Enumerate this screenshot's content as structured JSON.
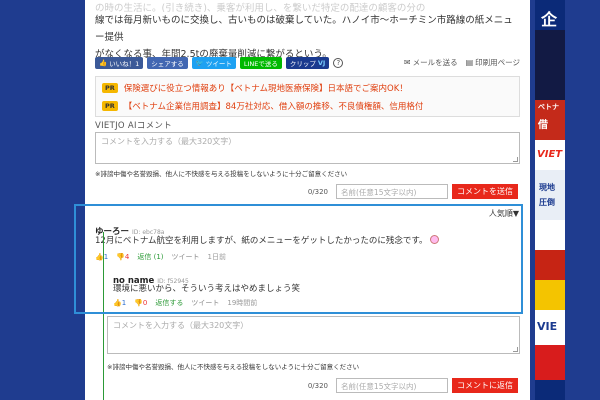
{
  "article": {
    "line1": "の時の生活に。(引き続き)、乗客が利用し、を繋いだ特定の配達の顧客の分の",
    "line2": "線では毎月新いものに交換し、古いものは破棄していた。ハノイ市～ホーチミン市路線の紙メニュー提供",
    "line3": "がなくなる事、年間2.5tの廃棄量削減に繋がるという。"
  },
  "share": {
    "like": "いいね！1",
    "share": "シェアする",
    "tweet": "ツイート",
    "line": "LINEで送る",
    "clip": "クリップ",
    "help": "?"
  },
  "tools": {
    "mail": "メールを送る",
    "print": "印刷用ページ"
  },
  "ads": [
    {
      "tag": "PR",
      "text": "保険選びに役立つ情報あり【ベトナム現地医療保険】日本語でご案内OK！"
    },
    {
      "tag": "PR",
      "text": "【ベトナム企業信用調査】84万社対応、借入額の推移、不良債権額、信用格付"
    }
  ],
  "comment_form": {
    "label": "VIETJO AIコメント",
    "placeholder": "コメントを入力する（最大320文字）",
    "warning": "※誹謗中傷や名誉毀損、他人に不快感を与える投稿をしないように十分ご留意ください",
    "count": "0/320",
    "name_placeholder": "名前(任意15文字以内)",
    "send": "コメントを送信"
  },
  "sort": "人気順▼",
  "comments": [
    {
      "user": "ゆーろー",
      "id": "ID: ebc78a",
      "text": "12月にベトナム航空を利用しますが、紙のメニューをゲットしたかったのに残念です。",
      "ok": "1",
      "ng": "4",
      "reply": "返信 (1)",
      "tweet": "ツイート",
      "time": "1日前"
    },
    {
      "user": "no name",
      "id": "ID: f52945",
      "text": "環境に悪いから、そういう考えはやめましょう笑",
      "ok": "1",
      "ng": "0",
      "reply": "返信する",
      "tweet": "ツイート",
      "time": "19時間前"
    }
  ],
  "reply_form": {
    "placeholder": "コメントを入力する（最大320文字）",
    "warning": "※誹謗中傷や名誉毀損、他人に不快感を与える投稿をしないように十分ご留意ください",
    "count": "0/320",
    "name_placeholder": "名前(任意15文字以内)",
    "send": "コメントに返信"
  },
  "sidebar": {
    "top": "企",
    "mid1": "ベトナ",
    "mid2": "借",
    "logo": "VIET",
    "p1": "現地",
    "p2": "圧倒",
    "logo2": "VIE"
  },
  "colors": {
    "accent": "#e8281b",
    "highlight": "#2f8fd7",
    "bg": "#1f3c8f"
  }
}
